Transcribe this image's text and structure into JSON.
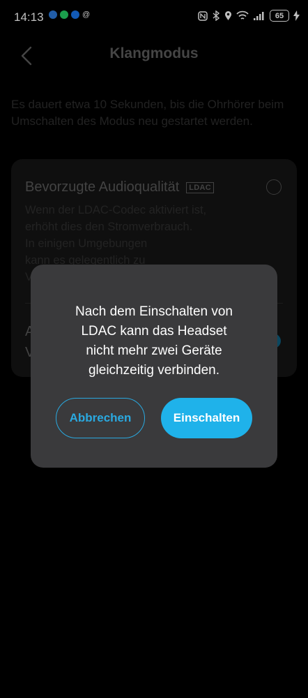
{
  "status_bar": {
    "time": "14:13",
    "battery": "65",
    "app_icons": [
      "calendar-icon",
      "whatsapp-icon",
      "facebook-icon",
      "at-icon"
    ]
  },
  "header": {
    "title": "Klangmodus"
  },
  "intro_text": "Es dauert etwa 10 Sekunden, bis die Ohrhörer beim Umschalten des Modus neu gestartet werden.",
  "options": [
    {
      "title": "Bevorzugte Audioqualität",
      "badge": "LDAC",
      "description": "Wenn der LDAC-Codec aktiviert ist,\nerhöht dies den Stromverbrauch.\nIn einigen Umgebungen\nkann es gelegentlich zu\nV",
      "selected": false
    },
    {
      "title": "A\nV",
      "selected": true
    }
  ],
  "dialog": {
    "message": "Nach dem Einschalten von\nLDAC kann das Headset\nnicht mehr zwei Geräte\ngleichzeitig verbinden.",
    "cancel_label": "Abbrechen",
    "confirm_label": "Einschalten"
  },
  "colors": {
    "accent": "#1fb2ea",
    "dialog_bg": "#3a3a3c",
    "background": "#000000"
  }
}
